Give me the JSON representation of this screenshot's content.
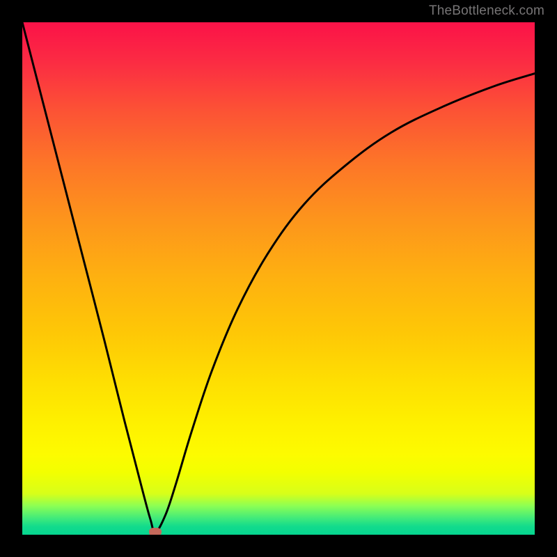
{
  "watermark": "TheBottleneck.com",
  "chart_data": {
    "type": "line",
    "title": "",
    "xlabel": "",
    "ylabel": "",
    "xlim": [
      0,
      100
    ],
    "ylim": [
      0,
      100
    ],
    "grid": false,
    "series": [
      {
        "name": "bottleneck-curve",
        "x": [
          0,
          4,
          8,
          12,
          16,
          20,
          23.5,
          25,
          26,
          28,
          30,
          33,
          37,
          42,
          48,
          55,
          63,
          72,
          82,
          92,
          100
        ],
        "y": [
          100,
          84.5,
          69,
          53.5,
          38,
          22,
          8.5,
          3,
          0.5,
          4,
          10,
          20,
          32,
          44,
          55,
          64.5,
          72,
          78.5,
          83.5,
          87.5,
          90
        ]
      }
    ],
    "markers": [
      {
        "name": "optimal-point",
        "x": 26,
        "y": 0.5
      }
    ],
    "background": {
      "type": "vertical-gradient",
      "stops": [
        {
          "pos": 0,
          "color": "#fb1248"
        },
        {
          "pos": 50,
          "color": "#fd941c"
        },
        {
          "pos": 80,
          "color": "#fef000"
        },
        {
          "pos": 93,
          "color": "#a0ff4a"
        },
        {
          "pos": 100,
          "color": "#06d690"
        }
      ]
    }
  }
}
